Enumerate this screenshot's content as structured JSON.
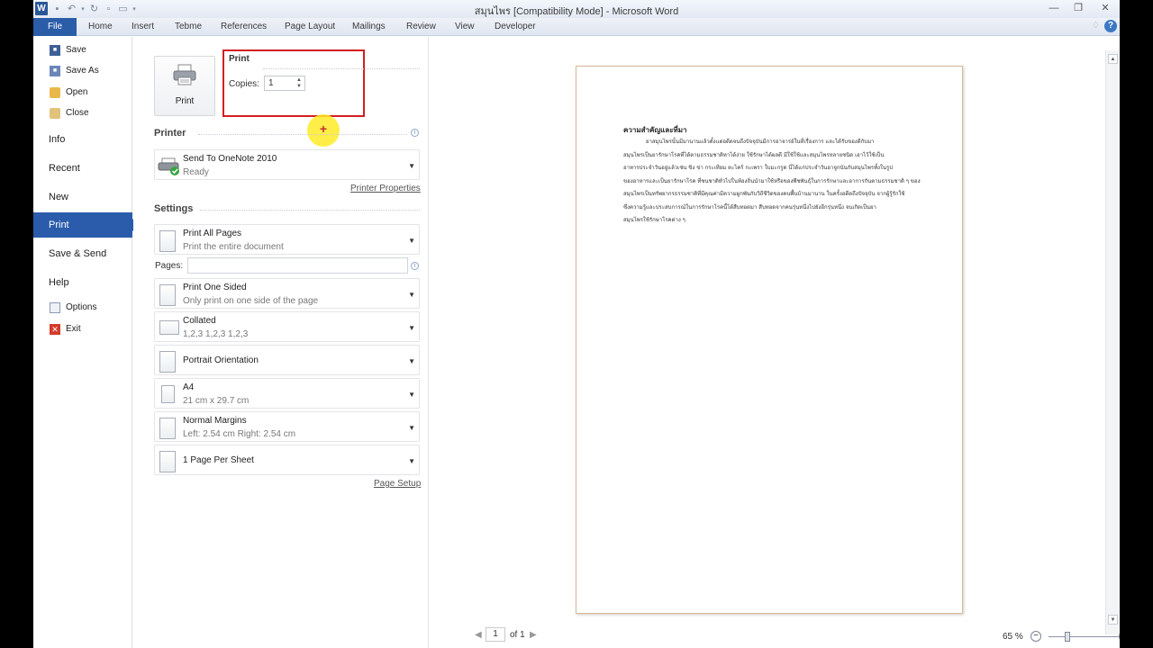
{
  "window": {
    "title": "สมุนไพร [Compatibility Mode] - Microsoft Word",
    "app_logo": "W"
  },
  "ribbon": {
    "tabs": [
      "File",
      "Home",
      "Insert",
      "Tebme",
      "References",
      "Page Layout",
      "Mailings",
      "Review",
      "View",
      "Developer"
    ],
    "help": "?"
  },
  "nav": {
    "save": "Save",
    "save_as": "Save As",
    "open": "Open",
    "close": "Close",
    "info": "Info",
    "recent": "Recent",
    "new": "New",
    "print": "Print",
    "save_send": "Save & Send",
    "help": "Help",
    "options": "Options",
    "exit": "Exit"
  },
  "print": {
    "button_label": "Print",
    "section_title": "Print",
    "copies_label": "Copies:",
    "copies_value": "1"
  },
  "printer": {
    "heading": "Printer",
    "name": "Send To OneNote 2010",
    "status": "Ready",
    "properties_link": "Printer Properties"
  },
  "settings": {
    "heading": "Settings",
    "pages_label": "Pages:",
    "pages_value": "",
    "items": [
      {
        "title": "Print All Pages",
        "subtitle": "Print the entire document",
        "icon": "pages-icon"
      },
      {
        "title": "Print One Sided",
        "subtitle": "Only print on one side of the page",
        "icon": "one-sided-icon"
      },
      {
        "title": "Collated",
        "subtitle": "1,2,3    1,2,3    1,2,3",
        "icon": "collated-icon"
      },
      {
        "title": "Portrait Orientation",
        "subtitle": "",
        "icon": "portrait-icon"
      },
      {
        "title": "A4",
        "subtitle": "21 cm x 29.7 cm",
        "icon": "paper-size-icon"
      },
      {
        "title": "Normal Margins",
        "subtitle": "Left:  2.54 cm    Right:  2.54 cm",
        "icon": "margins-icon"
      },
      {
        "title": "1 Page Per Sheet",
        "subtitle": "",
        "icon": "pages-per-sheet-icon"
      }
    ],
    "page_setup_link": "Page Setup"
  },
  "preview": {
    "doc_heading": "ความสำคัญและที่มา",
    "doc_lines": [
      "ยาสมุนไพรนั้นมีมานานแล้วตั้งแต่อดีตจนถึงปัจจุบันมีการอาจารย์ในที่เรื่องการ และได้รับของดีกับมา",
      "สมุนไพรเป็นยารักษาโรคที่ได้ตามธรรมชาติหาได้ง่าย ใช้รักษาได้ผลดี มีใช้ใช้และสมุนไพรหลายชนิด เอาไว้ใช้เป็น",
      "อาหารประจำวันอยู่แล้วเช่น ขิง ข่า กระเทียม ตะไคร้ กะเพรา ใบมะกรูด นี่ได้แก่ประจำวันอาจูกนันกับสมุนไพรทั้งในรูป",
      "ของอาหารและเป็นยารักษาโรค ที่ชนชาติทั่วไปในท้องถิ่นนำมาใช้หรือของพืชพันธุ์ในการรักษาและอาการกันตามธรรมชาติ ๆ ของพืช",
      "สมุนไพรเป็นทรัพยากรธรรมชาติที่มีคุณค่ามีความผูกพันกับวิถีชีวิตของคนพื้นบ้านมานาน ในครั้งอดีตถึงปัจจุบัน จากผู้รู้รักใช้",
      "ซึ่งความรู้และประสบการณ์ในการรักษาโรคนี้ได้สืบทอดมา สืบทอดจากคนรุ่นหนึ่งไปยังอีกรุ่นหนึ่ง จนเกิดเป็นยา",
      "สมุนไพรใช้รักษาโรคต่าง ๆ"
    ],
    "page_current": "1",
    "page_of": "of 1",
    "zoom": "65 %"
  }
}
